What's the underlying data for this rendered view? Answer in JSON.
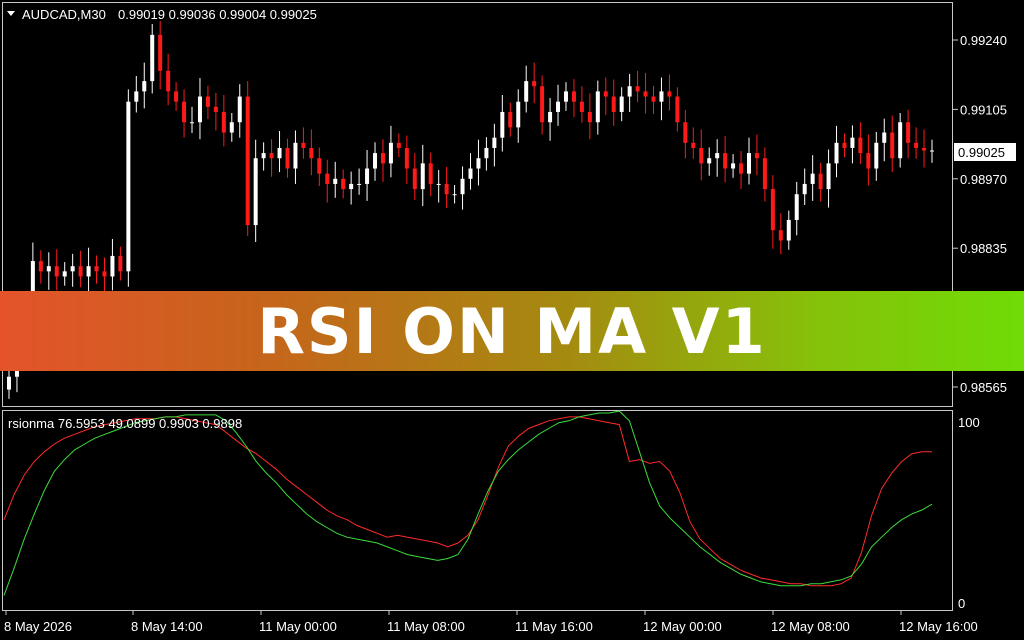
{
  "main_chart": {
    "symbol": "AUDCAD,M30",
    "ohlc": "0.99019 0.99036 0.99004 0.99025",
    "current_price_label": "0.99025",
    "price_ticks": [
      "0.99240",
      "0.99105",
      "0.98970",
      "0.98835",
      "0.98565"
    ]
  },
  "indicator": {
    "label": "rsionma 76.5953 49.0899 0.9903 0.9898",
    "scale_top": "100",
    "scale_bottom": "0"
  },
  "time_ticks": [
    "8 May 2026",
    "8 May 14:00",
    "11 May 00:00",
    "11 May 08:00",
    "11 May 16:00",
    "12 May 00:00",
    "12 May 08:00",
    "12 May 16:00"
  ],
  "banner": {
    "title": "RSI ON MA V1"
  },
  "colors": {
    "up": "#ffffff",
    "down": "#ff1a1a",
    "rsi": "#ff2a2a",
    "ma": "#3cdc3c",
    "grid": "#c8c8c8"
  },
  "chart_data": {
    "type": "line",
    "title": "",
    "panes": [
      "price candlesticks",
      "rsionma"
    ],
    "price_ylim": [
      0.9853,
      0.9931
    ],
    "close": [
      0.98585,
      0.9862,
      0.9872,
      0.9881,
      0.9879,
      0.988,
      0.9878,
      0.9879,
      0.988,
      0.9878,
      0.988,
      0.9879,
      0.9878,
      0.9882,
      0.9879,
      0.9912,
      0.9914,
      0.9916,
      0.9925,
      0.9918,
      0.9914,
      0.9912,
      0.9908,
      0.9908,
      0.9913,
      0.9911,
      0.991,
      0.9906,
      0.9908,
      0.9913,
      0.9888,
      0.9901,
      0.9902,
      0.9901,
      0.9903,
      0.9899,
      0.9904,
      0.9903,
      0.9901,
      0.9898,
      0.9896,
      0.9897,
      0.9895,
      0.9896,
      0.9896,
      0.9899,
      0.9902,
      0.99,
      0.9904,
      0.9903,
      0.9899,
      0.9895,
      0.99,
      0.9896,
      0.9896,
      0.9894,
      0.9894,
      0.9897,
      0.9899,
      0.9901,
      0.9903,
      0.9905,
      0.991,
      0.9907,
      0.9912,
      0.9916,
      0.9915,
      0.9908,
      0.991,
      0.9912,
      0.9914,
      0.9912,
      0.991,
      0.9908,
      0.9914,
      0.9913,
      0.991,
      0.9913,
      0.9915,
      0.9914,
      0.9913,
      0.9912,
      0.9914,
      0.9913,
      0.9908,
      0.9904,
      0.9903,
      0.99,
      0.9901,
      0.9902,
      0.9899,
      0.99,
      0.9898,
      0.9902,
      0.9901,
      0.9895,
      0.9887,
      0.9885,
      0.9889,
      0.9894,
      0.9896,
      0.9898,
      0.9895,
      0.99,
      0.9904,
      0.9903,
      0.9905,
      0.9902,
      0.9899,
      0.9904,
      0.9906,
      0.9901,
      0.9908,
      0.9904,
      0.9903,
      0.99025,
      0.99025
    ],
    "rsi": [
      45,
      58,
      68,
      75,
      80,
      84,
      87,
      89,
      91,
      93,
      94,
      95,
      96,
      97,
      97,
      97,
      98,
      98,
      97,
      96,
      95,
      94,
      90,
      86,
      82,
      79,
      75,
      71,
      66,
      62,
      58,
      54,
      50,
      47,
      45,
      42,
      40,
      38,
      36,
      37,
      36,
      35,
      34,
      33,
      31,
      33,
      37,
      45,
      58,
      72,
      83,
      88,
      92,
      94,
      96,
      97,
      98,
      98,
      97,
      96,
      95,
      94,
      75,
      76,
      74,
      75,
      70,
      59,
      44,
      35,
      30,
      25,
      22,
      19,
      17,
      15,
      14,
      13,
      12,
      12,
      11,
      11,
      11,
      12,
      15,
      28,
      47,
      61,
      69,
      75,
      79,
      80,
      80
    ],
    "ma": [
      6,
      20,
      35,
      48,
      60,
      70,
      76,
      81,
      84,
      87,
      89,
      91,
      93,
      95,
      96,
      97,
      98,
      98,
      99,
      99,
      99,
      99,
      96,
      90,
      83,
      75,
      69,
      64,
      58,
      53,
      48,
      44,
      41,
      38,
      36,
      35,
      34,
      33,
      31,
      29,
      27,
      26,
      25,
      24,
      25,
      27,
      35,
      48,
      60,
      70,
      76,
      81,
      85,
      89,
      92,
      95,
      96,
      98,
      99,
      100,
      100,
      101,
      96,
      80,
      64,
      52,
      46,
      41,
      36,
      31,
      27,
      23,
      20,
      17,
      15,
      13,
      12,
      11,
      11,
      11,
      12,
      12,
      13,
      14,
      16,
      22,
      31,
      36,
      41,
      45,
      48,
      50,
      53
    ]
  }
}
